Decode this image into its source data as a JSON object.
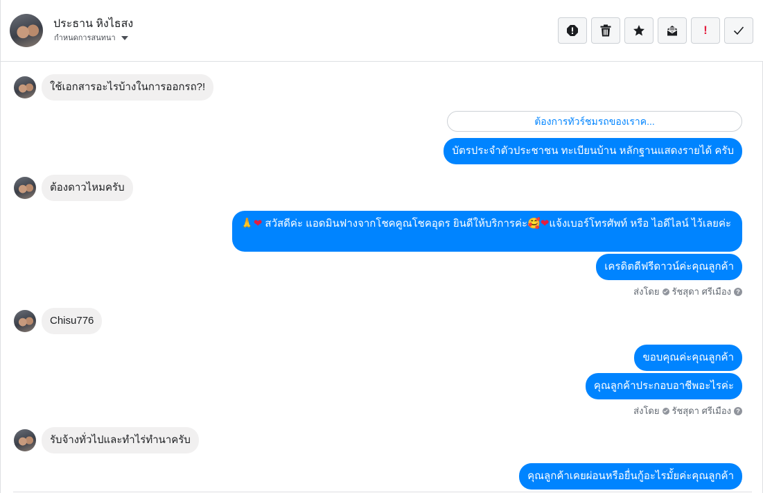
{
  "header": {
    "contact_name": "ประธาน หิงไธสง",
    "assign_label": "กำหนดการสนทนา",
    "toolbar": [
      {
        "name": "report-icon"
      },
      {
        "name": "trash-icon"
      },
      {
        "name": "star-icon"
      },
      {
        "name": "mark-unread-icon"
      },
      {
        "name": "flag-icon",
        "glyph": "!"
      },
      {
        "name": "done-check-icon"
      }
    ]
  },
  "messages": [
    {
      "dir": "in",
      "text": "ใช้เอกสารอะไรบ้างในการออกรถ?!"
    },
    {
      "dir": "quick",
      "text": "ต้องการทัวร์ชมรถของเราค..."
    },
    {
      "dir": "out",
      "text": "บัตรประจำตัวประชาชน ทะเบียนบ้าน หลักฐานแสดงรายได้ ครับ"
    },
    {
      "dir": "in",
      "text": "ต้องดาวไหมครับ"
    },
    {
      "dir": "out",
      "text_a": "🙏",
      "text_b": "❤",
      "text_c": " สวัสดีค่ะ แอดมินฟางจากโชคคูณโชคอุดร ยินดีให้บริการค่ะ",
      "text_d": "🥰",
      "text_e": "❤",
      "text_f": "แจ้งเบอร์โทรศัพท์ หรือ ไอดีไลน์  ไว้เลยค่ะ"
    },
    {
      "dir": "out",
      "text": "เครดิตดีฟรีดาวน์ค่ะคุณลูกค้า"
    },
    {
      "dir": "sent_by",
      "label": "ส่งโดย",
      "agent": "รัชสุดา ศรีเมือง"
    },
    {
      "dir": "in",
      "text": "Chisu776"
    },
    {
      "dir": "out",
      "text": "ขอบคุณค่ะคุณลูกค้า"
    },
    {
      "dir": "out",
      "text": "คุณลูกค้าประกอบอาชีพอะไรค่ะ"
    },
    {
      "dir": "sent_by",
      "label": "ส่งโดย",
      "agent": "รัชสุดา ศรีเมือง"
    },
    {
      "dir": "in",
      "text": "รับจ้างทั่วไปและทำไร่ทำนาครับ"
    },
    {
      "dir": "out",
      "text": "คุณลูกค้าเคยผ่อนหรือยื่นกู้อะไรมั้ยค่ะคุณลูกค้า"
    }
  ],
  "colors": {
    "outgoing": "#0084ff",
    "incoming": "#f1f0f0",
    "border": "#dddfe2"
  }
}
